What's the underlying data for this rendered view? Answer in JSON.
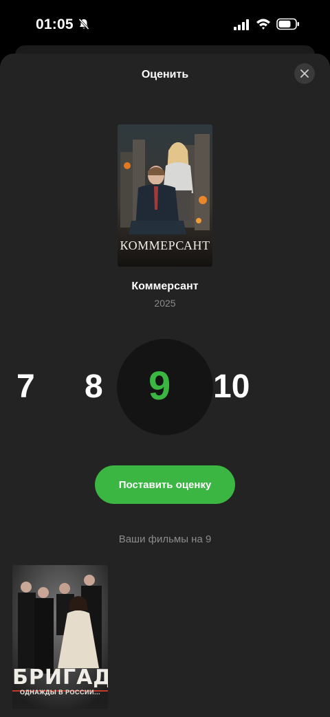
{
  "status_bar": {
    "time": "01:05"
  },
  "sheet": {
    "title": "Оценить",
    "close_icon": "close-icon"
  },
  "movie": {
    "poster_title": "КОММЕРСАНТ",
    "title": "Коммерсант",
    "year": "2025"
  },
  "rating": {
    "options": [
      "7",
      "8",
      "9",
      "10"
    ],
    "selected": "9",
    "selected_color": "#3bb643"
  },
  "submit_label": "Поставить оценку",
  "your_films": {
    "heading": "Ваши фильмы на 9",
    "items": [
      {
        "poster_title": "БРИГАДА",
        "poster_subtitle": "ОДНАЖДЫ В РОССИИ..."
      }
    ]
  },
  "colors": {
    "accent": "#3bb643",
    "sheet_bg": "#232323",
    "muted_text": "#8c8c8c"
  }
}
